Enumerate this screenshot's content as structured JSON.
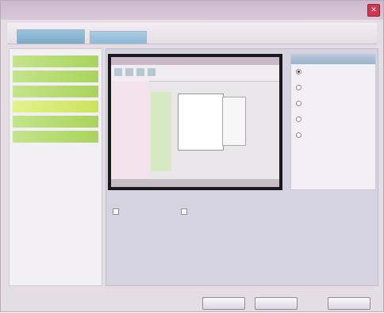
{
  "window": {
    "title": "",
    "close_icon": "close-icon"
  },
  "tabs": [
    {
      "label": ""
    },
    {
      "label": ""
    }
  ],
  "sidebar": {
    "items": [
      {
        "label": ""
      },
      {
        "label": ""
      },
      {
        "label": ""
      },
      {
        "label": ""
      },
      {
        "label": ""
      },
      {
        "label": ""
      }
    ]
  },
  "options": {
    "header": "",
    "items": [
      {
        "label": ""
      },
      {
        "label": ""
      },
      {
        "label": ""
      },
      {
        "label": ""
      },
      {
        "label": ""
      }
    ]
  },
  "caption": "",
  "checkboxes": [
    {
      "label": ""
    },
    {
      "label": ""
    }
  ],
  "buttons": {
    "ok": "",
    "cancel": "",
    "apply": ""
  },
  "colors": {
    "accent": "#7fb3d5",
    "nav_green": "#b8dc73",
    "close_red": "#d3374a"
  }
}
